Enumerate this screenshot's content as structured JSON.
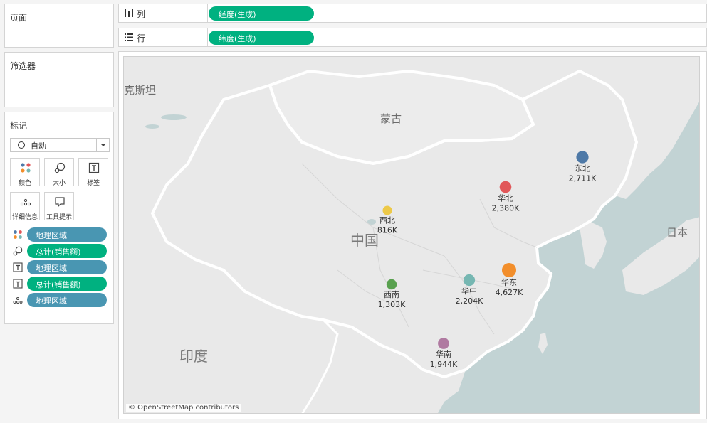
{
  "panels": {
    "pages": "页面",
    "filters": "筛选器",
    "marks": "标记"
  },
  "marks": {
    "type_label": "自动",
    "buttons": {
      "color": "颜色",
      "size": "大小",
      "label": "标签",
      "detail": "详细信息",
      "tooltip": "工具提示"
    },
    "shelf": [
      {
        "encoding": "color",
        "field": "地理区域"
      },
      {
        "encoding": "size",
        "field": "总计(销售额)"
      },
      {
        "encoding": "label",
        "field": "地理区域"
      },
      {
        "encoding": "label",
        "field": "总计(销售额)"
      },
      {
        "encoding": "detail",
        "field": "地理区域"
      }
    ]
  },
  "columns": {
    "label": "列",
    "pill": "经度(生成)"
  },
  "rows": {
    "label": "行",
    "pill": "纬度(生成)"
  },
  "map": {
    "countries": [
      "克斯坦",
      "蒙古",
      "中国",
      "日本",
      "印度"
    ],
    "credit": "© OpenStreetMap contributors",
    "regions": [
      {
        "name": "东北",
        "value": "2,711K",
        "sales_k": 2711,
        "color": "#4e79a7"
      },
      {
        "name": "华北",
        "value": "2,380K",
        "sales_k": 2380,
        "color": "#e15759"
      },
      {
        "name": "西北",
        "value": "816K",
        "sales_k": 816,
        "color": "#edc948"
      },
      {
        "name": "华东",
        "value": "4,627K",
        "sales_k": 4627,
        "color": "#f28e2b"
      },
      {
        "name": "华中",
        "value": "2,204K",
        "sales_k": 2204,
        "color": "#76b7b2"
      },
      {
        "name": "西南",
        "value": "1,303K",
        "sales_k": 1303,
        "color": "#59a14f"
      },
      {
        "name": "华南",
        "value": "1,944K",
        "sales_k": 1944,
        "color": "#b07aa1"
      }
    ]
  }
}
